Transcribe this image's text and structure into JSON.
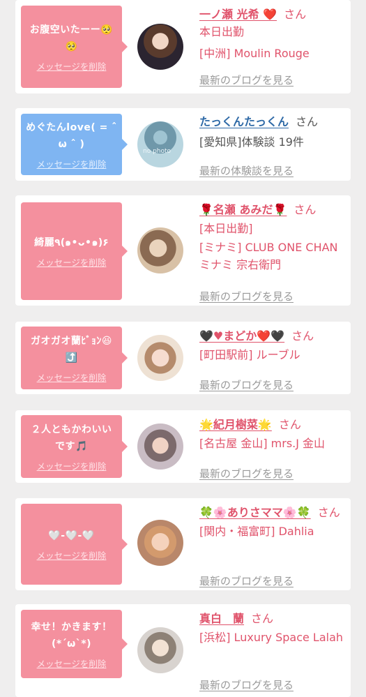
{
  "delete_label": "メッセージを削除",
  "honorific": "さん",
  "colors": {
    "pink_bubble": "#f4909e",
    "blue_bubble": "#7fb5f2",
    "accent": "#e0536b",
    "link_blue": "#2f6aa7",
    "muted": "#999999"
  },
  "cards": [
    {
      "message": "お腹空いたーー🥺🥺",
      "name": "一ノ瀬 光希 ❤️",
      "details": [
        "本日出勤",
        "[中洲] Moulin Rouge"
      ],
      "link": "最新のブログを見る"
    },
    {
      "message": "めぐたんlove( = ˆ ω ˆ )",
      "name": "たっくんたっくん",
      "details": [
        "[愛知県]体験談 19件"
      ],
      "link": "最新の体験談を見る",
      "avatar_text": "no photo"
    },
    {
      "message": "綺麗٩(๑•ᴗ•๑)۶",
      "name": "🌹名瀬 あみだ🌹",
      "details": [
        "[本日出勤]",
        "[ミナミ] CLUB ONE CHAN ミナミ 宗右衛門"
      ],
      "link": "最新のブログを見る"
    },
    {
      "message": "ガオガオ蘭ﾋﾞｮﾝ😆⤴️",
      "name": "🖤♥まどか❤️🖤",
      "details": [
        "[町田駅前] ルーブル"
      ],
      "link": "最新のブログを見る"
    },
    {
      "message": "２人ともかわいいです🎵",
      "name": "🌟紀月樹菜🌟",
      "details": [
        "[名古屋 金山] mrs.J 金山"
      ],
      "link": "最新のブログを見る"
    },
    {
      "message": "🤍-🤍-🤍",
      "name": "🍀🌸ありさママ🌸🍀",
      "details": [
        "[関内・福富町] Dahlia"
      ],
      "link": "最新のブログを見る"
    },
    {
      "message": "幸せ！かきます！(*´ω`*)",
      "name": "真白　蘭",
      "details": [
        "[浜松] Luxury Space Lalah"
      ],
      "link": "最新のブログを見る"
    }
  ]
}
